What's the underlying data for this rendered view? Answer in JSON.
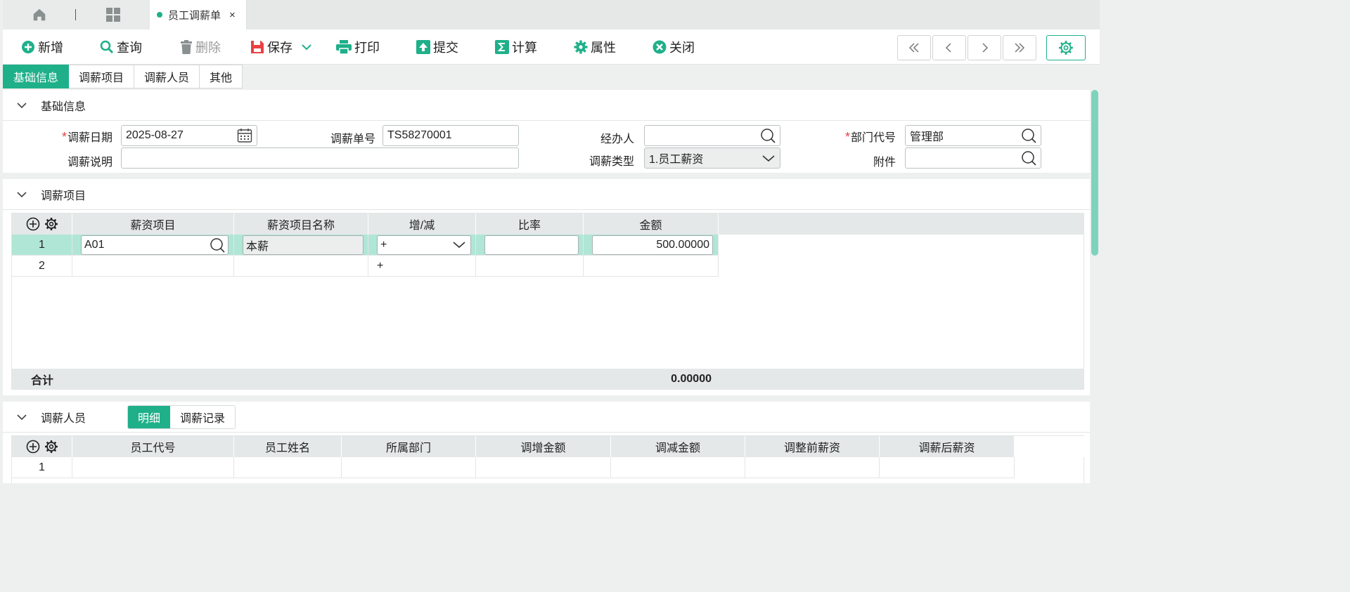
{
  "tabs": {
    "document_tab": "员工调薪单",
    "close_glyph": "×"
  },
  "toolbar": {
    "new": "新增",
    "query": "查询",
    "delete": "删除",
    "save": "保存",
    "print": "打印",
    "submit": "提交",
    "calculate": "计算",
    "properties": "属性",
    "close": "关闭"
  },
  "section_tabs": [
    "基础信息",
    "调薪项目",
    "调薪人员",
    "其他"
  ],
  "basic_info": {
    "title": "基础信息",
    "date_label": "调薪日期",
    "date_value": "2025-08-27",
    "number_label": "调薪单号",
    "number_value": "TS58270001",
    "handler_label": "经办人",
    "handler_value": "",
    "dept_label": "部门代号",
    "dept_value": "管理部",
    "note_label": "调薪说明",
    "note_value": "",
    "type_label": "调薪类型",
    "type_value": "1.员工薪资",
    "attach_label": "附件",
    "attach_value": "",
    "required_mark": "*"
  },
  "items": {
    "title": "调薪项目",
    "columns": [
      "薪资项目",
      "薪资项目名称",
      "增/减",
      "比率",
      "金额"
    ],
    "rows": [
      {
        "no": "1",
        "code": "A01",
        "name": "本薪",
        "op": "+",
        "rate": "",
        "amount": "500.00000"
      },
      {
        "no": "2",
        "code": "",
        "name": "",
        "op": "+",
        "rate": "",
        "amount": ""
      }
    ],
    "total_label": "合计",
    "total_amount": "0.00000"
  },
  "staff": {
    "title": "调薪人员",
    "subtabs": [
      "明细",
      "调薪记录"
    ],
    "columns": [
      "员工代号",
      "员工姓名",
      "所属部门",
      "调增金额",
      "调减金额",
      "调整前薪资",
      "调薪后薪资"
    ],
    "rows": [
      {
        "no": "1"
      }
    ]
  },
  "colors": {
    "accent": "#1fb08a",
    "selected_row": "#b0e6d6",
    "required": "#e84141"
  },
  "icons": [
    "home-icon",
    "apps-grid-icon",
    "plus-circle-icon",
    "search-icon",
    "trash-icon",
    "save-icon",
    "chevron-down-icon",
    "print-icon",
    "upload-icon",
    "sigma-icon",
    "gear-icon",
    "close-circle-icon",
    "calendar-icon",
    "first-page-icon",
    "prev-page-icon",
    "next-page-icon",
    "last-page-icon"
  ]
}
